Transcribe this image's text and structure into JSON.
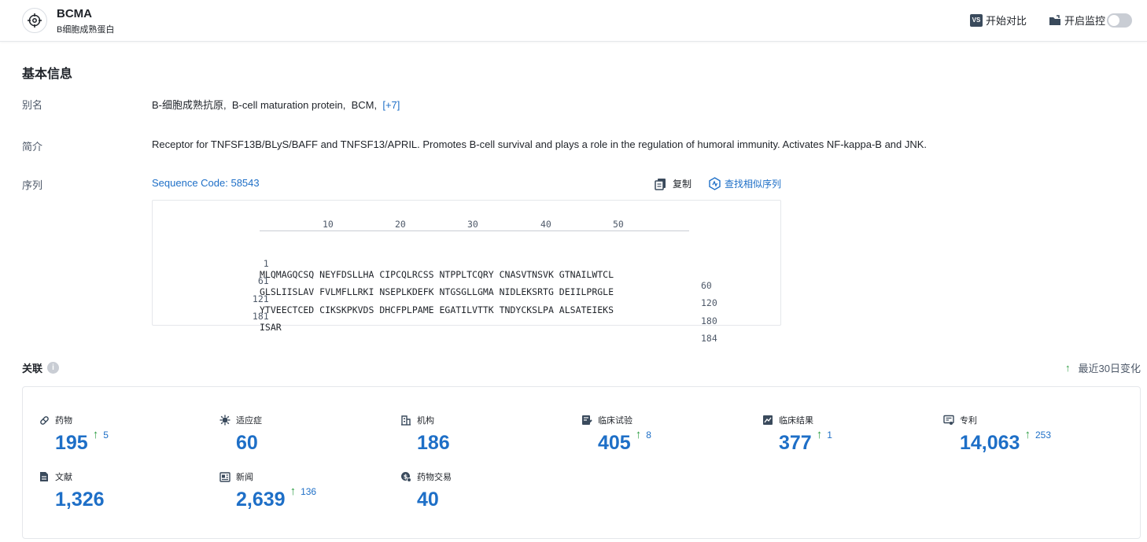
{
  "header": {
    "title": "BCMA",
    "subtitle": "B细胞成熟蛋白",
    "compare_label": "开始对比",
    "compare_badge": "VS",
    "monitor_label": "开启监控"
  },
  "basic_info": {
    "title": "基本信息",
    "alias": {
      "label": "别名",
      "values": [
        "B-细胞成熟抗原,",
        "B-cell maturation protein,",
        "BCM,"
      ],
      "more": "[+7]"
    },
    "summary": {
      "label": "简介",
      "text": "Receptor for TNFSF13B/BLyS/BAFF and TNFSF13/APRIL. Promotes B-cell survival and plays a role in the regulation of humoral immunity. Activates NF-kappa-B and JNK."
    },
    "sequence": {
      "label": "序列",
      "code_link": "Sequence Code: 58543",
      "copy_label": "复制",
      "search_label": "查找相似序列",
      "ruler": [
        "10",
        "20",
        "30",
        "40",
        "50"
      ],
      "rows": [
        {
          "start": "1",
          "seq": "MLQMAGQCSQ NEYFDSLLHA CIPCQLRCSS NTPPLTCQRY CNASVTNSVK GTNAILWTCL",
          "end": "60"
        },
        {
          "start": "61",
          "seq": "GLSLIISLAV FVLMFLLRKI NSEPLKDEFK NTGSGLLGMA NIDLEKSRTG DEIILPRGLE",
          "end": "120"
        },
        {
          "start": "121",
          "seq": "YTVEECTCED CIKSKPKVDS DHCFPLPAME EGATILVTTK TNDYCKSLPA ALSATEIEKS",
          "end": "180"
        },
        {
          "start": "181",
          "seq": "ISAR",
          "end": "184"
        }
      ]
    }
  },
  "related": {
    "title": "关联",
    "info_icon": "i",
    "change_note": "最近30日变化",
    "stats": [
      {
        "key": "drug",
        "label": "药物",
        "value": "195",
        "delta": "5",
        "icon": "pill-icon"
      },
      {
        "key": "indication",
        "label": "适应症",
        "value": "60",
        "delta": "",
        "icon": "virus-icon"
      },
      {
        "key": "org",
        "label": "机构",
        "value": "186",
        "delta": "",
        "icon": "building-icon"
      },
      {
        "key": "trial",
        "label": "临床试验",
        "value": "405",
        "delta": "8",
        "icon": "clipboard-edit-icon"
      },
      {
        "key": "result",
        "label": "临床结果",
        "value": "377",
        "delta": "1",
        "icon": "chart-report-icon"
      },
      {
        "key": "patent",
        "label": "专利",
        "value": "14,063",
        "delta": "253",
        "icon": "patent-icon"
      },
      {
        "key": "literature",
        "label": "文献",
        "value": "1,326",
        "delta": "",
        "icon": "document-icon"
      },
      {
        "key": "news",
        "label": "新闻",
        "value": "2,639",
        "delta": "136",
        "icon": "newspaper-icon"
      },
      {
        "key": "deal",
        "label": "药物交易",
        "value": "40",
        "delta": "",
        "icon": "deal-icon"
      }
    ]
  },
  "colors": {
    "accent": "#1e6fc7",
    "up": "#2f9e44",
    "label_gray": "#4e5969"
  }
}
